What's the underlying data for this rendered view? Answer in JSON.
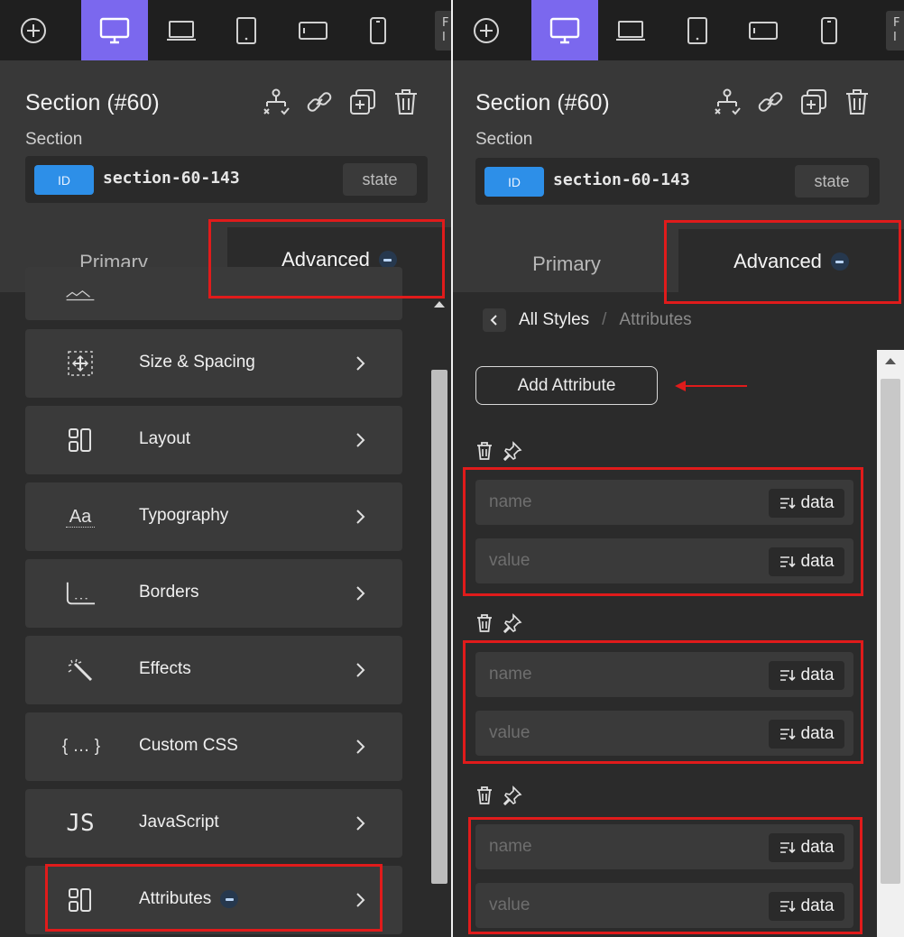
{
  "toolbar": {
    "add_icon": "plus-circle-icon",
    "devices": [
      "desktop-icon",
      "laptop-icon",
      "tablet-icon",
      "tablet-landscape-icon",
      "mobile-icon"
    ],
    "active_device": "desktop-icon",
    "accent_color": "#7b68ee",
    "cut_off_label": "F\nI"
  },
  "header": {
    "title": "Section (#60)",
    "subtitle": "Section",
    "actions": [
      "structure-icon",
      "link-icon",
      "duplicate-icon",
      "trash-icon"
    ],
    "id_badge": "ID",
    "id_value": "section-60-143",
    "state_label": "state"
  },
  "tabs": {
    "primary": "Primary",
    "advanced": "Advanced"
  },
  "left_list": {
    "items": [
      {
        "label": "",
        "icon": "background-icon"
      },
      {
        "label": "Size & Spacing",
        "icon": "size-spacing-icon"
      },
      {
        "label": "Layout",
        "icon": "layout-icon"
      },
      {
        "label": "Typography",
        "icon": "typography-icon"
      },
      {
        "label": "Borders",
        "icon": "borders-icon"
      },
      {
        "label": "Effects",
        "icon": "magic-wand-icon"
      },
      {
        "label": "Custom CSS",
        "icon": "braces-icon"
      },
      {
        "label": "JavaScript",
        "icon": "js-icon"
      },
      {
        "label": "Attributes",
        "icon": "attributes-icon"
      }
    ],
    "custom_css_glyph": "{ … }",
    "js_glyph": "JS",
    "typo_glyph": "Aa"
  },
  "right": {
    "breadcrumb": {
      "current": "All Styles",
      "separator": "/",
      "page": "Attributes"
    },
    "add_button": "Add Attribute",
    "attributes": [
      {
        "name_placeholder": "name",
        "value_placeholder": "value",
        "data_label": "data"
      },
      {
        "name_placeholder": "name",
        "value_placeholder": "value",
        "data_label": "data"
      },
      {
        "name_placeholder": "name",
        "value_placeholder": "value",
        "data_label": "data"
      }
    ]
  },
  "colors": {
    "highlight": "#e01b1b",
    "id_badge": "#2d8fe8",
    "panel": "#2b2b2b"
  }
}
